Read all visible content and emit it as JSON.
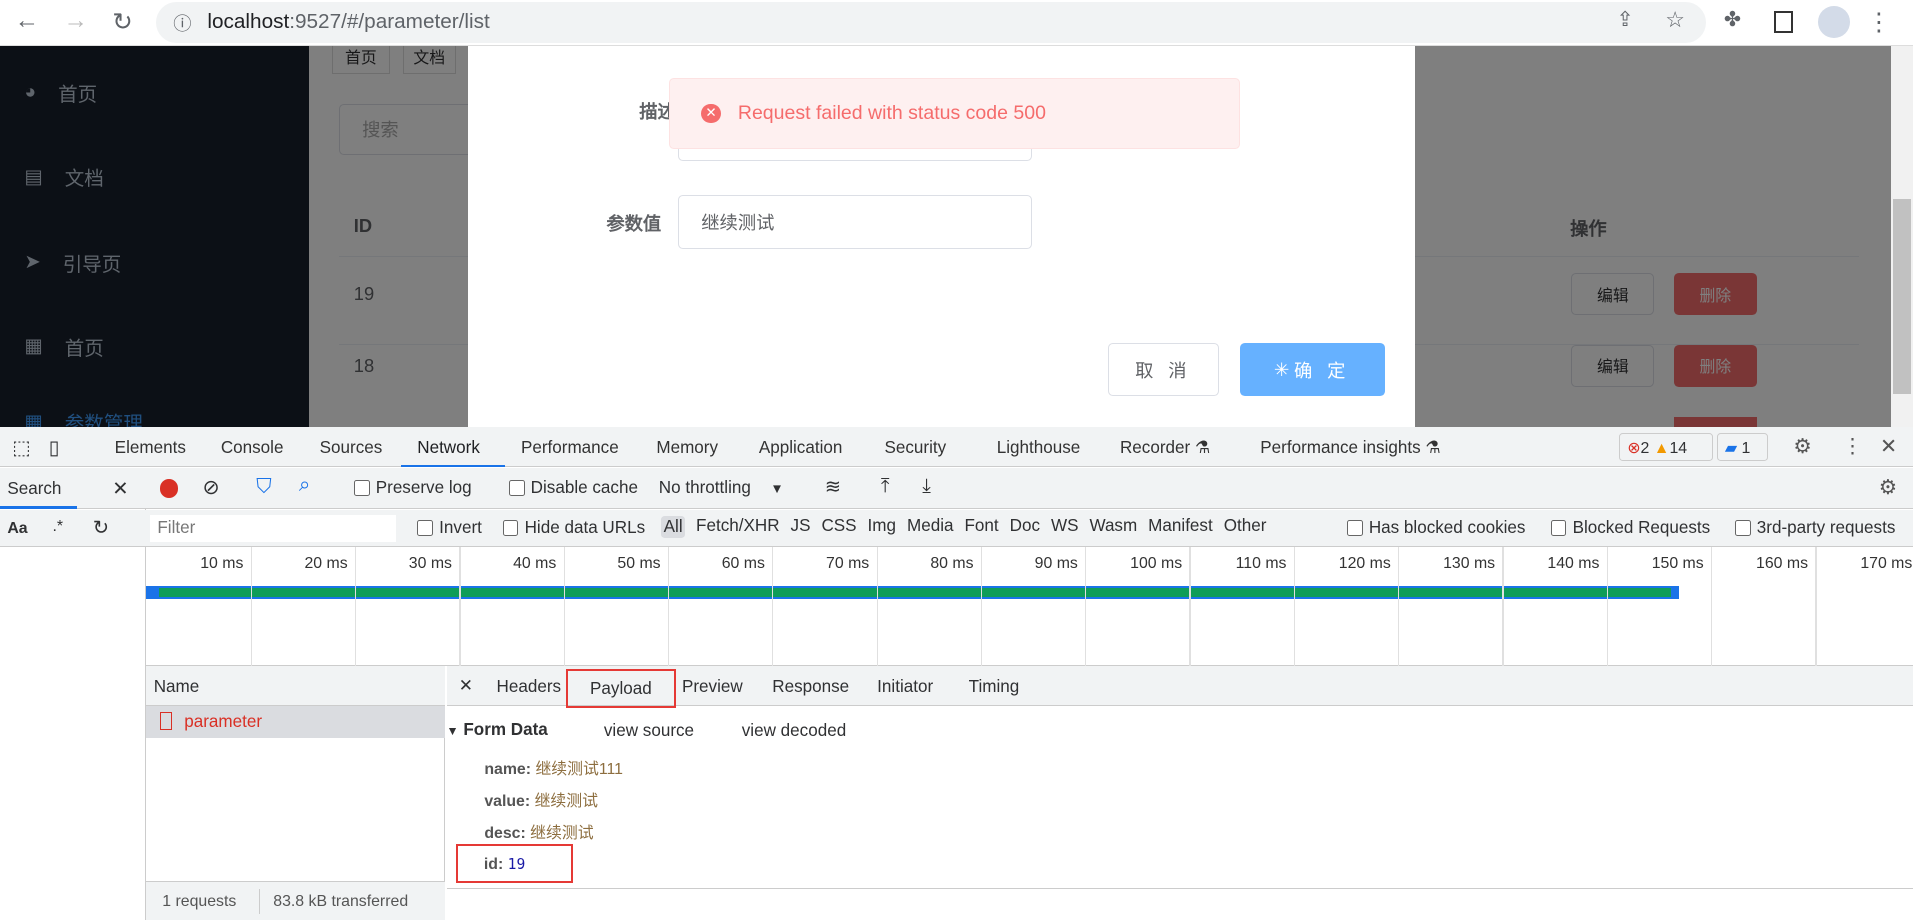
{
  "browser": {
    "url_host": "localhost",
    "url_rest": ":9527/#/parameter/list"
  },
  "sidebar": {
    "items": [
      {
        "label": "首页",
        "icon": "dashboard-icon"
      },
      {
        "label": "文档",
        "icon": "document-icon"
      },
      {
        "label": "引导页",
        "icon": "paper-plane-icon"
      },
      {
        "label": "首页",
        "icon": "table-icon"
      },
      {
        "label": "参数管理",
        "icon": "table-icon"
      }
    ]
  },
  "page": {
    "tags": [
      "首页",
      "文档"
    ],
    "search_placeholder": "搜索",
    "col_id": "ID",
    "col_ops": "操作",
    "rows": [
      {
        "id": "19",
        "edit": "编辑",
        "delete": "删除"
      },
      {
        "id": "18",
        "edit": "编辑",
        "delete": "删除"
      }
    ]
  },
  "dialog": {
    "desc_label": "描述",
    "value_label": "参数值",
    "value_input": "继续测试",
    "cancel": "取 消",
    "confirm": "确 定"
  },
  "message": {
    "text": "Request failed with status code 500",
    "type": "error",
    "color": "#f56c6c"
  },
  "devtools": {
    "tabs": [
      "Elements",
      "Console",
      "Sources",
      "Network",
      "Performance",
      "Memory",
      "Application",
      "Security",
      "Lighthouse",
      "Recorder",
      "Performance insights"
    ],
    "active_tab": "Network",
    "errors": "2",
    "warnings": "14",
    "messages": "1",
    "search_label": "Search",
    "aa": "Aa",
    "regex": ".*",
    "preserve_log": "Preserve log",
    "disable_cache": "Disable cache",
    "throttling": "No throttling",
    "filter_placeholder": "Filter",
    "invert": "Invert",
    "hide_data_urls": "Hide data URLs",
    "types": [
      "All",
      "Fetch/XHR",
      "JS",
      "CSS",
      "Img",
      "Media",
      "Font",
      "Doc",
      "WS",
      "Wasm",
      "Manifest",
      "Other"
    ],
    "has_blocked_cookies": "Has blocked cookies",
    "blocked_requests": "Blocked Requests",
    "third_party": "3rd-party requests",
    "ticks": [
      "10 ms",
      "20 ms",
      "30 ms",
      "40 ms",
      "50 ms",
      "60 ms",
      "70 ms",
      "80 ms",
      "90 ms",
      "100 ms",
      "110 ms",
      "120 ms",
      "130 ms",
      "140 ms",
      "150 ms",
      "160 ms",
      "170 ms"
    ],
    "name_header": "Name",
    "request": "parameter",
    "detail_tabs": [
      "Headers",
      "Payload",
      "Preview",
      "Response",
      "Initiator",
      "Timing"
    ],
    "active_detail": "Payload",
    "form_data": "Form Data",
    "view_source": "view source",
    "view_decoded": "view decoded",
    "fields": [
      {
        "k": "name:",
        "v": "继续测试111"
      },
      {
        "k": "value:",
        "v": "继续测试"
      },
      {
        "k": "desc:",
        "v": "继续测试"
      },
      {
        "k": "id:",
        "v": "19"
      }
    ],
    "status_requests": "1 requests",
    "status_transferred": "83.8 kB transferred"
  }
}
